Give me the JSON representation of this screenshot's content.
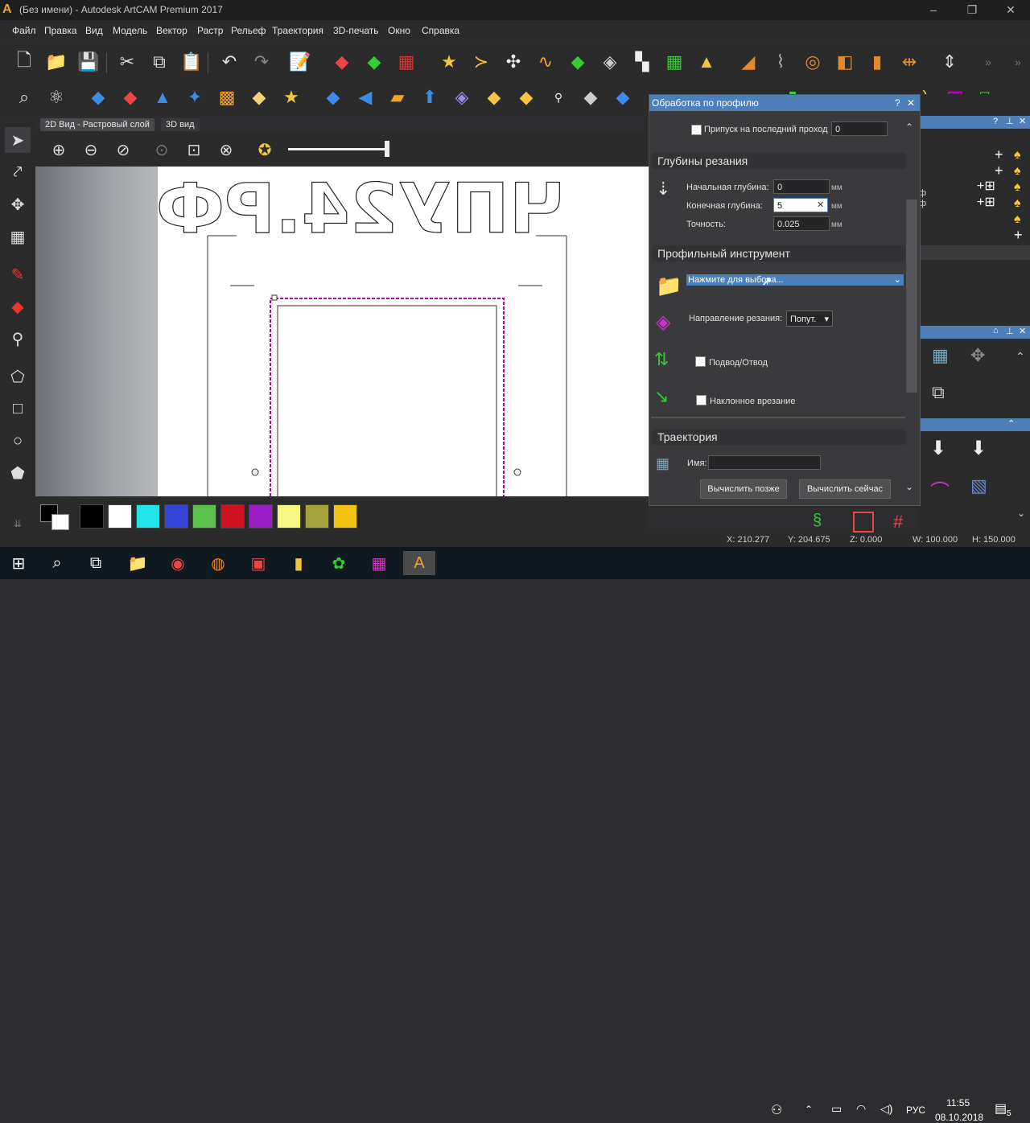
{
  "window": {
    "title": "(Без имени) - Autodesk ArtCAM Premium 2017",
    "logo": "A"
  },
  "window_controls": {
    "minimize": "–",
    "restore": "❐",
    "close": "✕"
  },
  "menu": [
    "Файл",
    "Правка",
    "Вид",
    "Модель",
    "Вектор",
    "Растр",
    "Рельеф",
    "Траектория",
    "3D-печать",
    "Окно",
    "Справка"
  ],
  "tabs": {
    "view2d": "2D Вид - Растровый слой",
    "view3d": "3D вид"
  },
  "canvas": {
    "design_text": "ЧПУ24.РФ"
  },
  "colors": {
    "accent": "#4d7fb8",
    "dialog_bg": "#3a3a3c",
    "selection": "#b000b0"
  },
  "palette": [
    "#000000",
    "#ffffff",
    "#22e5ea",
    "#3344d8",
    "#5cc04c",
    "#d0121e",
    "#9a1ec8",
    "#f6f681",
    "#a3a33a",
    "#f2c315"
  ],
  "status": {
    "x": "X: 210.277",
    "y": "Y: 204.675",
    "z": "Z: 0.000",
    "w": "W: 100.000",
    "h": "H: 150.000"
  },
  "dialog": {
    "title": "Обработка по профилю",
    "help": "?",
    "close": "✕",
    "last_pass_label": "Припуск на последний проход",
    "last_pass_value": "0",
    "depth_section": "Глубины резания",
    "start_depth_label": "Начальная глубина:",
    "start_depth_value": "0",
    "end_depth_label": "Конечная глубина:",
    "end_depth_value": "5",
    "tolerance_label": "Точность:",
    "tolerance_value": "0.025",
    "unit": "мм",
    "tool_section": "Профильный инструмент",
    "tool_select": "Нажмите для выбора...",
    "direction_label": "Направление резания:",
    "direction_value": "Попут.",
    "leadin_label": "Подвод/Отвод",
    "ramp_label": "Наклонное врезание",
    "toolpath_section": "Траектория",
    "name_label": "Имя:",
    "name_value": "",
    "calc_later": "Вычислить позже",
    "calc_now": "Вычислить сейчас"
  },
  "rightdock": {
    "fi_1": "ф",
    "fi_2": "ф"
  },
  "taskbar": {
    "lang": "РУС",
    "time": "11:55",
    "date": "08.10.2018",
    "notif": "5"
  }
}
